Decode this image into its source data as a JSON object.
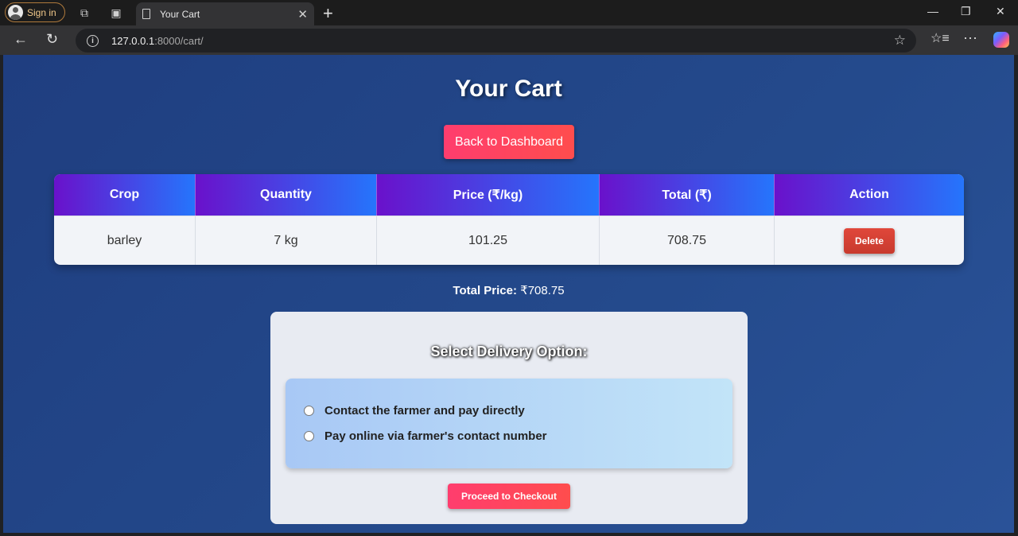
{
  "browser": {
    "signin_label": "Sign in",
    "tab_title": "Your Cart",
    "url_host": "127.0.0.1",
    "url_path": ":8000/cart/"
  },
  "page": {
    "heading": "Your Cart",
    "back_button": "Back to Dashboard",
    "table": {
      "headers": [
        "Crop",
        "Quantity",
        "Price (₹/kg)",
        "Total (₹)",
        "Action"
      ],
      "rows": [
        {
          "crop": "barley",
          "quantity": "7 kg",
          "price": "101.25",
          "total": "708.75",
          "action": "Delete"
        }
      ]
    },
    "total_label": "Total Price:",
    "total_value": "₹708.75",
    "delivery": {
      "title": "Select Delivery Option:",
      "options": [
        {
          "label": "Contact the farmer and pay directly",
          "selected": false
        },
        {
          "label": "Pay online via farmer's contact number",
          "selected": false
        }
      ],
      "checkout_button": "Proceed to Checkout"
    }
  },
  "colors": {
    "page_bg": "#244a8c",
    "header_gradient_start": "#6a11cb",
    "header_gradient_end": "#2575fc",
    "primary_button": "#ff3d6e",
    "delete_button": "#d8403a"
  }
}
